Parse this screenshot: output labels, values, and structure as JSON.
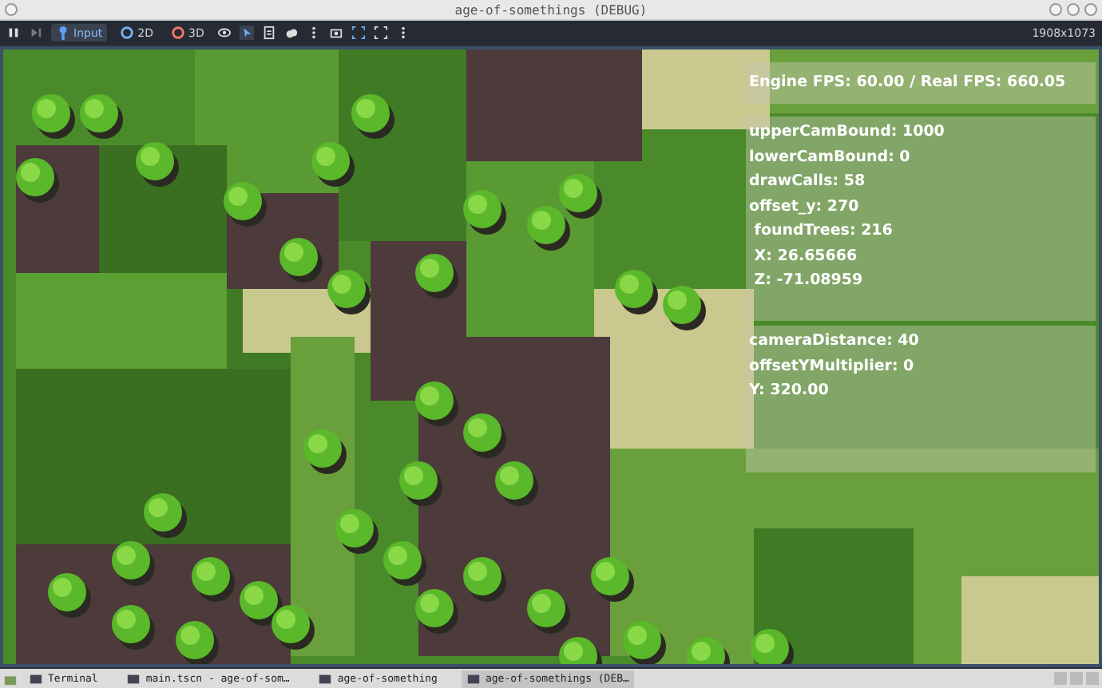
{
  "window": {
    "title": "age-of-somethings (DEBUG)"
  },
  "toolbar": {
    "modes": [
      {
        "label": "Input",
        "selected": true,
        "kind": "input"
      },
      {
        "label": "2D",
        "selected": false,
        "kind": "plane"
      },
      {
        "label": "3D",
        "selected": false,
        "kind": "space"
      }
    ],
    "resolution": "1908x1073"
  },
  "overlay": {
    "header": "Engine FPS: 60.00 / Real FPS: 660.05",
    "stats": [
      "upperCamBound: 1000",
      "lowerCamBound: 0",
      "drawCalls: 58",
      "offset_y: 270",
      " foundTrees: 216",
      " X: 26.65666",
      " Z: -71.08959"
    ],
    "camera": [
      "cameraDistance: 40",
      "offsetYMultiplier: 0",
      "Y: 320.00"
    ]
  },
  "taskbar": {
    "items": [
      {
        "label": "Terminal",
        "selected": false
      },
      {
        "label": "main.tscn - age-of-som…",
        "selected": false
      },
      {
        "label": "age-of-something",
        "selected": false
      },
      {
        "label": "age-of-somethings (DEB…",
        "selected": true
      }
    ]
  }
}
